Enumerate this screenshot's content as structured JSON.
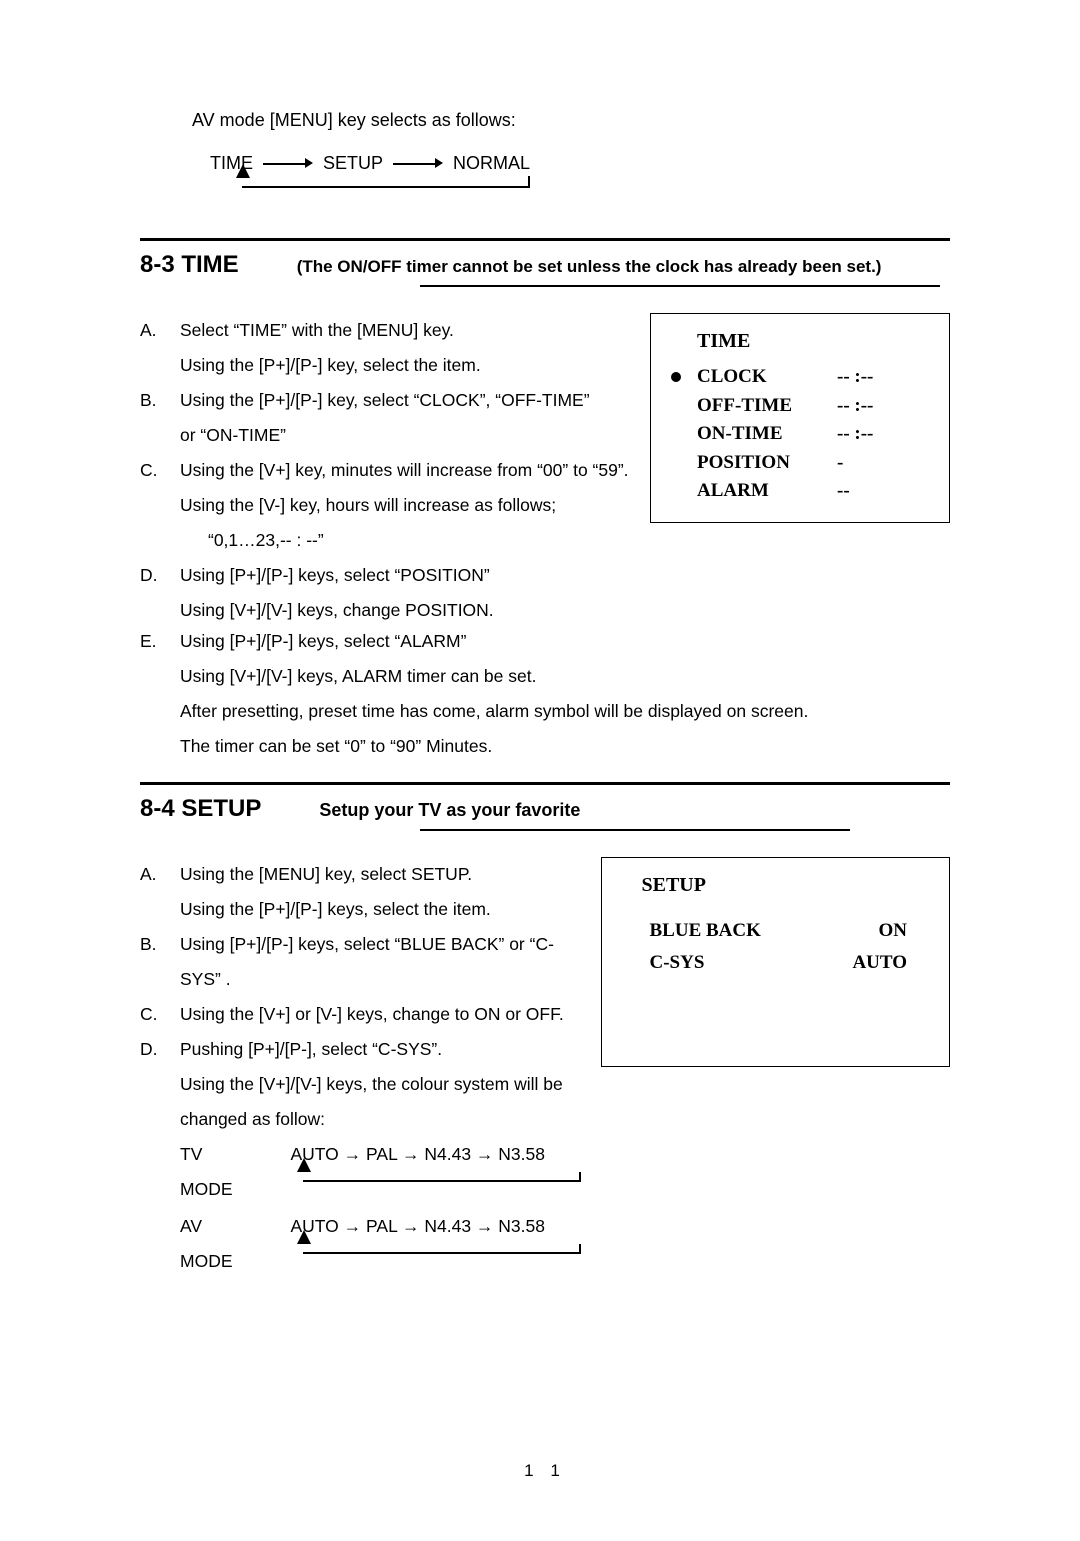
{
  "intro": "AV mode [MENU] key selects as follows:",
  "flow": {
    "a": "TIME",
    "b": "SETUP",
    "c": "NORMAL"
  },
  "sec83": {
    "title": "8-3 TIME",
    "sub": "(The ON/OFF timer cannot be set unless the clock has already been set.)",
    "A1": "Select “TIME” with the [MENU] key.",
    "A2": "Using the [P+]/[P-] key, select the item.",
    "B1": "Using the [P+]/[P-] key, select “CLOCK”, “OFF-TIME”",
    "B2": "or “ON-TIME”",
    "C1": "Using the [V+] key, minutes will increase from “00” to “59”.",
    "C2": "Using the [V-] key, hours will increase as follows;",
    "C3": "“0,1…23,-- : --”",
    "D1": "Using [P+]/[P-] keys, select “POSITION”",
    "D2": "Using [V+]/[V-] keys, change POSITION.",
    "E1": "Using [P+]/[P-] keys, select “ALARM”",
    "E2": "Using [V+]/[V-] keys, ALARM timer can be set.",
    "E3": "After presetting, preset time has come, alarm symbol will be displayed on screen.",
    "E4": "The timer can be set “0” to “90” Minutes."
  },
  "timePanel": {
    "title": "TIME",
    "rows": [
      {
        "k": "CLOCK",
        "v": "-- :--",
        "bullet": true
      },
      {
        "k": "OFF-TIME",
        "v": "-- :--",
        "bullet": false
      },
      {
        "k": "ON-TIME",
        "v": "-- :--",
        "bullet": false
      },
      {
        "k": "POSITION",
        "v": "-",
        "bullet": false
      },
      {
        "k": "ALARM",
        "v": "--",
        "bullet": false
      }
    ]
  },
  "sec84": {
    "title": "8-4   SETUP",
    "sub": "Setup your TV as your favorite",
    "A1": "Using the [MENU] key, select SETUP.",
    "A2": "Using the [P+]/[P-] keys, select the item.",
    "B": "Using [P+]/[P-] keys, select “BLUE BACK” or “C-SYS” .",
    "C": "Using the [V+] or [V-] keys, change to ON or OFF.",
    "D1": "Pushing [P+]/[P-], select “C-SYS”.",
    "D2": "Using the [V+]/[V-] keys, the colour system will be",
    "D3": "changed  as follow:",
    "tvmode_label": "TV MODE",
    "avmode_label": "AV MODE",
    "chain": "AUTO → PAL → N4.43 → N3.58"
  },
  "setupPanel": {
    "title": "SETUP",
    "rows": [
      {
        "k": "BLUE BACK",
        "v": "ON"
      },
      {
        "k": "C-SYS",
        "v": "AUTO"
      }
    ]
  },
  "pageNumber": "1 1"
}
